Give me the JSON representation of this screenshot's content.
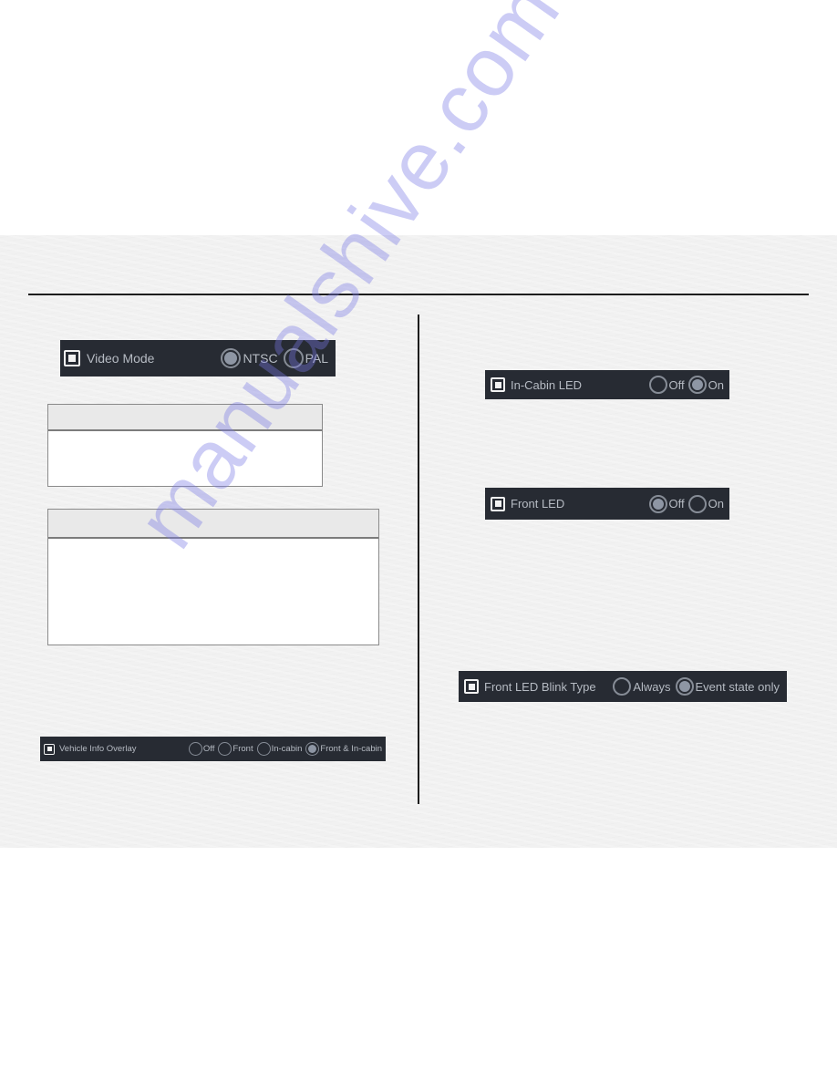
{
  "watermark": "manualshive.com",
  "colors": {
    "page_background": "#f1f1f1",
    "settings_bar": "#272b33",
    "settings_text": "#b6bbc3",
    "radio_selected_fill": "#8e96a4",
    "table_header": "#e9e9e9",
    "rule": "#1d1d1d",
    "watermark": "#7878e6"
  },
  "left_column": {
    "video_mode": {
      "label": "Video Mode",
      "options": [
        {
          "label": "NTSC",
          "selected": true
        },
        {
          "label": "PAL",
          "selected": false
        }
      ]
    },
    "tables": [
      {
        "header": "",
        "body": ""
      },
      {
        "header": "",
        "body": ""
      }
    ],
    "vehicle_info_overlay": {
      "label": "Vehicle Info Overlay",
      "options": [
        {
          "label": "Off",
          "selected": false
        },
        {
          "label": "Front",
          "selected": false
        },
        {
          "label": "In-cabin",
          "selected": false
        },
        {
          "label": "Front & In-cabin",
          "selected": true
        }
      ]
    }
  },
  "right_column": {
    "in_cabin_led": {
      "label": "In-Cabin LED",
      "options": [
        {
          "label": "Off",
          "selected": false
        },
        {
          "label": "On",
          "selected": true
        }
      ]
    },
    "front_led": {
      "label": "Front LED",
      "options": [
        {
          "label": "Off",
          "selected": true
        },
        {
          "label": "On",
          "selected": false
        }
      ]
    },
    "front_led_blink_type": {
      "label": "Front LED Blink Type",
      "options": [
        {
          "label": "Always",
          "selected": false
        },
        {
          "label": "Event state only",
          "selected": true
        }
      ]
    }
  }
}
